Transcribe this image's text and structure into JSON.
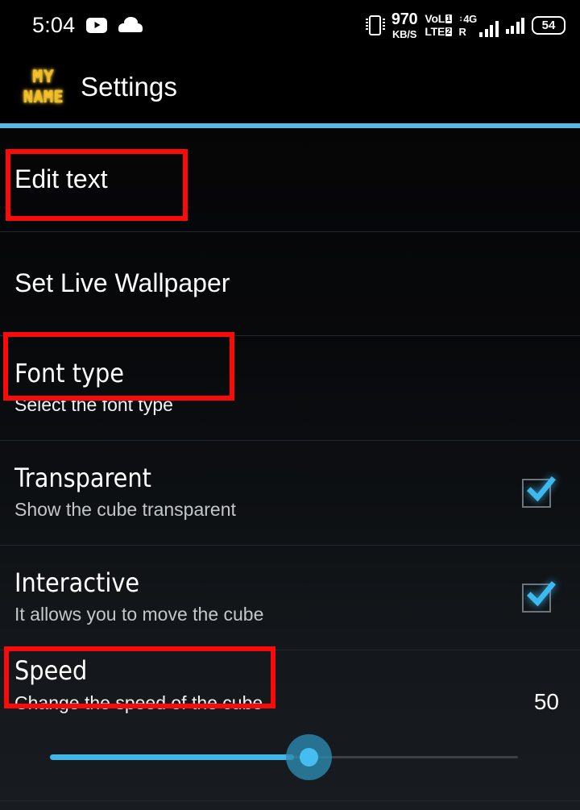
{
  "status_bar": {
    "clock": "5:04",
    "icons_left": [
      "youtube-icon",
      "cloud-icon"
    ],
    "vibrate_icon": "vibrate-icon",
    "net_speed_value": "970",
    "net_speed_unit": "KB/S",
    "volte_line1": "VoL",
    "volte_badge1": "1",
    "volte_line2": "LTE",
    "volte_badge2": "2",
    "sim_network": "4G",
    "sim_roaming": "R",
    "battery_level": "54"
  },
  "app_bar": {
    "icon_line1": "MY",
    "icon_line2": "NAME",
    "title": "Settings",
    "accent_color": "#4dbce6"
  },
  "settings": {
    "rows": [
      {
        "title": "Edit text",
        "subtitle": "",
        "control": "none"
      },
      {
        "title": "Set Live Wallpaper",
        "subtitle": "",
        "control": "none"
      },
      {
        "title": "Font type",
        "subtitle": "Select the font type",
        "control": "none"
      },
      {
        "title": "Transparent",
        "subtitle": "Show the cube transparent",
        "control": "checkbox",
        "checked": true
      },
      {
        "title": "Interactive",
        "subtitle": "It allows you to move the cube",
        "control": "checkbox",
        "checked": true
      },
      {
        "title": "Speed",
        "subtitle": "Change the speed of the cube",
        "control": "slider",
        "value": "50",
        "slider_percent": 50,
        "slider_min": 0,
        "slider_max": 100
      }
    ]
  },
  "annotations": {
    "color": "#fb0a0a",
    "boxes": [
      {
        "target": "Edit text"
      },
      {
        "target": "Font type"
      },
      {
        "target": "Speed"
      }
    ]
  }
}
